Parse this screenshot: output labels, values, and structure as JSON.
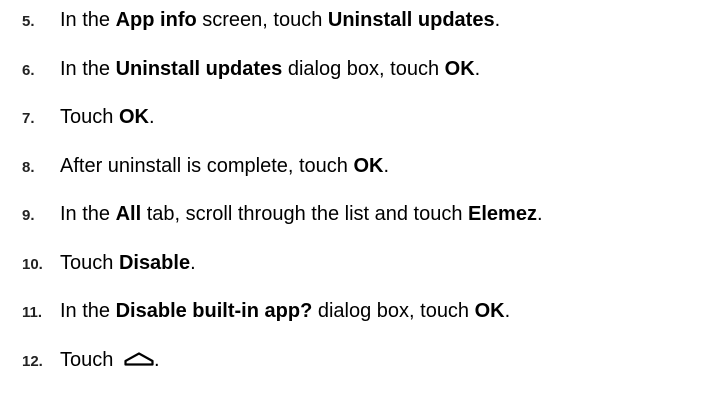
{
  "steps": [
    {
      "number": "5.",
      "parts": [
        {
          "t": "In the ",
          "b": false
        },
        {
          "t": "App info",
          "b": true
        },
        {
          "t": " screen, touch ",
          "b": false
        },
        {
          "t": "Uninstall updates",
          "b": true
        },
        {
          "t": ".",
          "b": false
        }
      ]
    },
    {
      "number": "6.",
      "parts": [
        {
          "t": "In the ",
          "b": false
        },
        {
          "t": "Uninstall updates",
          "b": true
        },
        {
          "t": " dialog box, touch ",
          "b": false
        },
        {
          "t": "OK",
          "b": true
        },
        {
          "t": ".",
          "b": false
        }
      ]
    },
    {
      "number": "7.",
      "parts": [
        {
          "t": "Touch ",
          "b": false
        },
        {
          "t": "OK",
          "b": true
        },
        {
          "t": ".",
          "b": false
        }
      ]
    },
    {
      "number": "8.",
      "parts": [
        {
          "t": "After uninstall is complete, touch ",
          "b": false
        },
        {
          "t": "OK",
          "b": true
        },
        {
          "t": ".",
          "b": false
        }
      ]
    },
    {
      "number": "9.",
      "parts": [
        {
          "t": "In the ",
          "b": false
        },
        {
          "t": "All",
          "b": true
        },
        {
          "t": " tab, scroll through the list and touch ",
          "b": false
        },
        {
          "t": "Elemez",
          "b": true
        },
        {
          "t": ".",
          "b": false
        }
      ]
    },
    {
      "number": "10.",
      "parts": [
        {
          "t": "Touch ",
          "b": false
        },
        {
          "t": "Disable",
          "b": true
        },
        {
          "t": ".",
          "b": false
        }
      ]
    },
    {
      "number": "11.",
      "parts": [
        {
          "t": "In the ",
          "b": false
        },
        {
          "t": "Disable built-in app?",
          "b": true
        },
        {
          "t": " dialog box, touch ",
          "b": false
        },
        {
          "t": "OK",
          "b": true
        },
        {
          "t": ".",
          "b": false
        }
      ]
    },
    {
      "number": "12.",
      "parts": [
        {
          "t": "Touch ",
          "b": false
        },
        {
          "icon": "home-icon"
        },
        {
          "t": ".",
          "b": false
        }
      ]
    }
  ]
}
